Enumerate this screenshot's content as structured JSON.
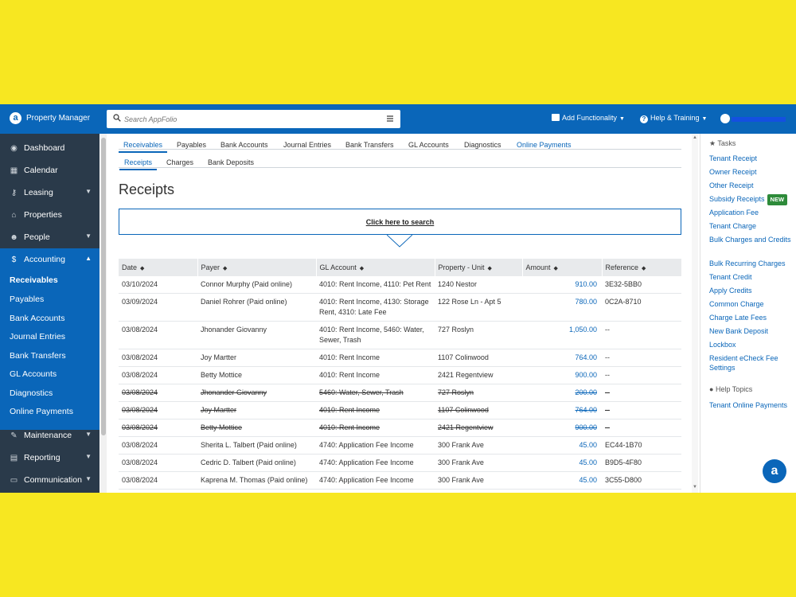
{
  "app": {
    "name": "Property Manager",
    "search_placeholder": "Search AppFolio",
    "add_functionality": "Add Functionality",
    "help_training": "Help & Training"
  },
  "sidebar": {
    "items": [
      {
        "label": "Dashboard",
        "icon": "dashboard-icon"
      },
      {
        "label": "Calendar",
        "icon": "calendar-icon"
      },
      {
        "label": "Leasing",
        "icon": "key-icon"
      },
      {
        "label": "Properties",
        "icon": "home-icon"
      },
      {
        "label": "People",
        "icon": "people-icon"
      },
      {
        "label": "Accounting",
        "icon": "dollar-icon"
      },
      {
        "label": "Maintenance",
        "icon": "wrench-icon"
      },
      {
        "label": "Reporting",
        "icon": "table-icon"
      },
      {
        "label": "Communication",
        "icon": "laptop-icon"
      }
    ],
    "accounting_sub": [
      "Receivables",
      "Payables",
      "Bank Accounts",
      "Journal Entries",
      "Bank Transfers",
      "GL Accounts",
      "Diagnostics",
      "Online Payments"
    ]
  },
  "tabs": [
    "Receivables",
    "Payables",
    "Bank Accounts",
    "Journal Entries",
    "Bank Transfers",
    "GL Accounts",
    "Diagnostics",
    "Online Payments"
  ],
  "subtabs": [
    "Receipts",
    "Charges",
    "Bank Deposits"
  ],
  "page_title": "Receipts",
  "search_link": "Click here to search",
  "table": {
    "headers": [
      "Date",
      "Payer",
      "GL Account",
      "Property - Unit",
      "Amount",
      "Reference"
    ],
    "rows": [
      [
        "03/10/2024",
        "Connor Murphy (Paid online)",
        "4010: Rent Income, 4110: Pet Rent",
        "1240 Nestor",
        "910.00",
        "3E32-5BB0"
      ],
      [
        "03/09/2024",
        "Daniel Rohrer (Paid online)",
        "4010: Rent Income, 4130: Storage Rent, 4310: Late Fee",
        "122 Rose Ln - Apt 5",
        "780.00",
        "0C2A-8710"
      ],
      [
        "03/08/2024",
        "Jhonander Giovanny",
        "4010: Rent Income, 5460: Water, Sewer, Trash",
        "727 Roslyn",
        "1,050.00",
        "--"
      ],
      [
        "03/08/2024",
        "Joy Martter",
        "4010: Rent Income",
        "1107 Colinwood",
        "764.00",
        "--"
      ],
      [
        "03/08/2024",
        "Betty Mottice",
        "4010: Rent Income",
        "2421 Regentview",
        "900.00",
        "--"
      ],
      [
        "03/08/2024",
        "Jhonander Giovanny",
        "5460: Water, Sewer, Trash",
        "727 Roslyn",
        "200.00",
        "--"
      ],
      [
        "03/08/2024",
        "Joy Martter",
        "4010: Rent Income",
        "1107 Colinwood",
        "764.00",
        "--"
      ],
      [
        "03/08/2024",
        "Betty Mottice",
        "4010: Rent Income",
        "2421 Regentview",
        "900.00",
        "--"
      ],
      [
        "03/08/2024",
        "Sherita L. Talbert (Paid online)",
        "4740: Application Fee Income",
        "300 Frank Ave",
        "45.00",
        "EC44-1B70"
      ],
      [
        "03/08/2024",
        "Cedric D. Talbert (Paid online)",
        "4740: Application Fee Income",
        "300 Frank Ave",
        "45.00",
        "B9D5-4F80"
      ],
      [
        "03/08/2024",
        "Kaprena M. Thomas (Paid online)",
        "4740: Application Fee Income",
        "300 Frank Ave",
        "45.00",
        "3C55-D800"
      ]
    ],
    "voided_rows": [
      5,
      6,
      7
    ]
  },
  "tasks": {
    "heading": "Tasks",
    "links": [
      "Tenant Receipt",
      "Owner Receipt",
      "Other Receipt",
      "Subsidy Receipts",
      "Application Fee",
      "Tenant Charge",
      "Bulk Charges and Credits",
      "Bulk Recurring Charges",
      "Tenant Credit",
      "Apply Credits",
      "Common Charge",
      "Charge Late Fees",
      "New Bank Deposit",
      "Lockbox",
      "Resident eCheck Fee Settings"
    ],
    "new_badge": "NEW"
  },
  "help_topics": {
    "heading": "Help Topics",
    "links": [
      "Tenant Online Payments"
    ]
  },
  "colors": {
    "brand": "#0a66b9",
    "sidebar": "#2a3a4a",
    "background": "#f7e721"
  }
}
